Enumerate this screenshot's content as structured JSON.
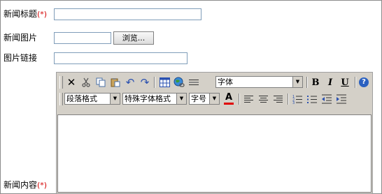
{
  "form": {
    "title_label": "新闻标题",
    "required_mark": "(*)",
    "title_value": "",
    "image_label": "新闻图片",
    "image_value": "",
    "browse_label": "浏览...",
    "link_label": "图片链接",
    "link_value": "",
    "content_label": "新闻内容",
    "content_required_mark": "(*)"
  },
  "editor": {
    "toolbar1": {
      "font_select": "字体",
      "bold": "B",
      "italic": "I",
      "underline": "U",
      "help": "?"
    },
    "toolbar2": {
      "paragraph_select": "段落格式",
      "special_select": "特殊字体格式",
      "size_select": "字号",
      "font_color": "A"
    },
    "colors": {
      "font_color_bar": "#e00000",
      "toolbar_bg": "#d4d0c8"
    }
  }
}
